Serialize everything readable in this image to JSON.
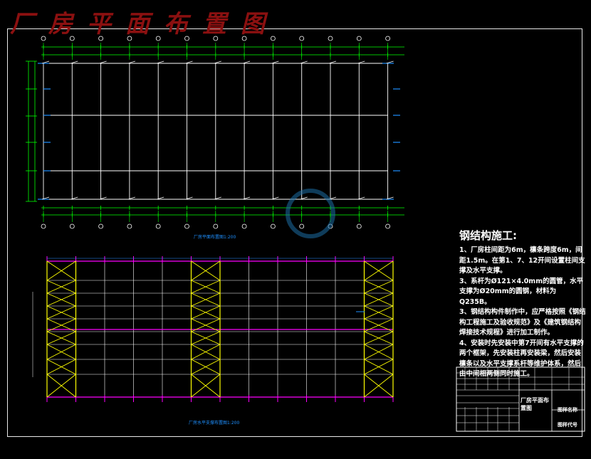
{
  "drawing_title": "厂房平面布置图",
  "plan_view": {
    "caption": "厂房平面布置图1:200"
  },
  "bracing_view": {
    "caption": "厂房水平支撑布置图1:200"
  },
  "notes": {
    "heading": "钢结构施工:",
    "items": [
      "1、厂房柱间距为6m，檩条跨度6m，间距1.5m。在第1、7、12开间设置柱间支撑及水平支撑。",
      "3、系杆为Ø121×4.0mm的圆管，水平支撑为Ø20mm的圆钢，材料为Q235B。",
      "3、钢结构构件制作中，应严格按照《钢结构工程施工及验收规范》及《建筑钢结构焊接技术规程》进行加工制作。",
      "4、安装时先安装中第7开间有水平支撑的两个框架，先安装柱再安装梁，然后安装檩条以及水平支撑系杆等维护体系，然后由中间相两侧同时施工。"
    ]
  },
  "title_block": {
    "drawing_name": "厂房平面布置图",
    "drawing_name_label": "图样名称",
    "drawing_code_label": "图样代号"
  },
  "colors": {
    "title": "#8b1010",
    "grid": "#ffffff",
    "dimension": "#00ff00",
    "brace": "#ffff00",
    "member": "#ff00ff",
    "caption": "#1e90ff",
    "watermark": "#1c6ea4"
  }
}
